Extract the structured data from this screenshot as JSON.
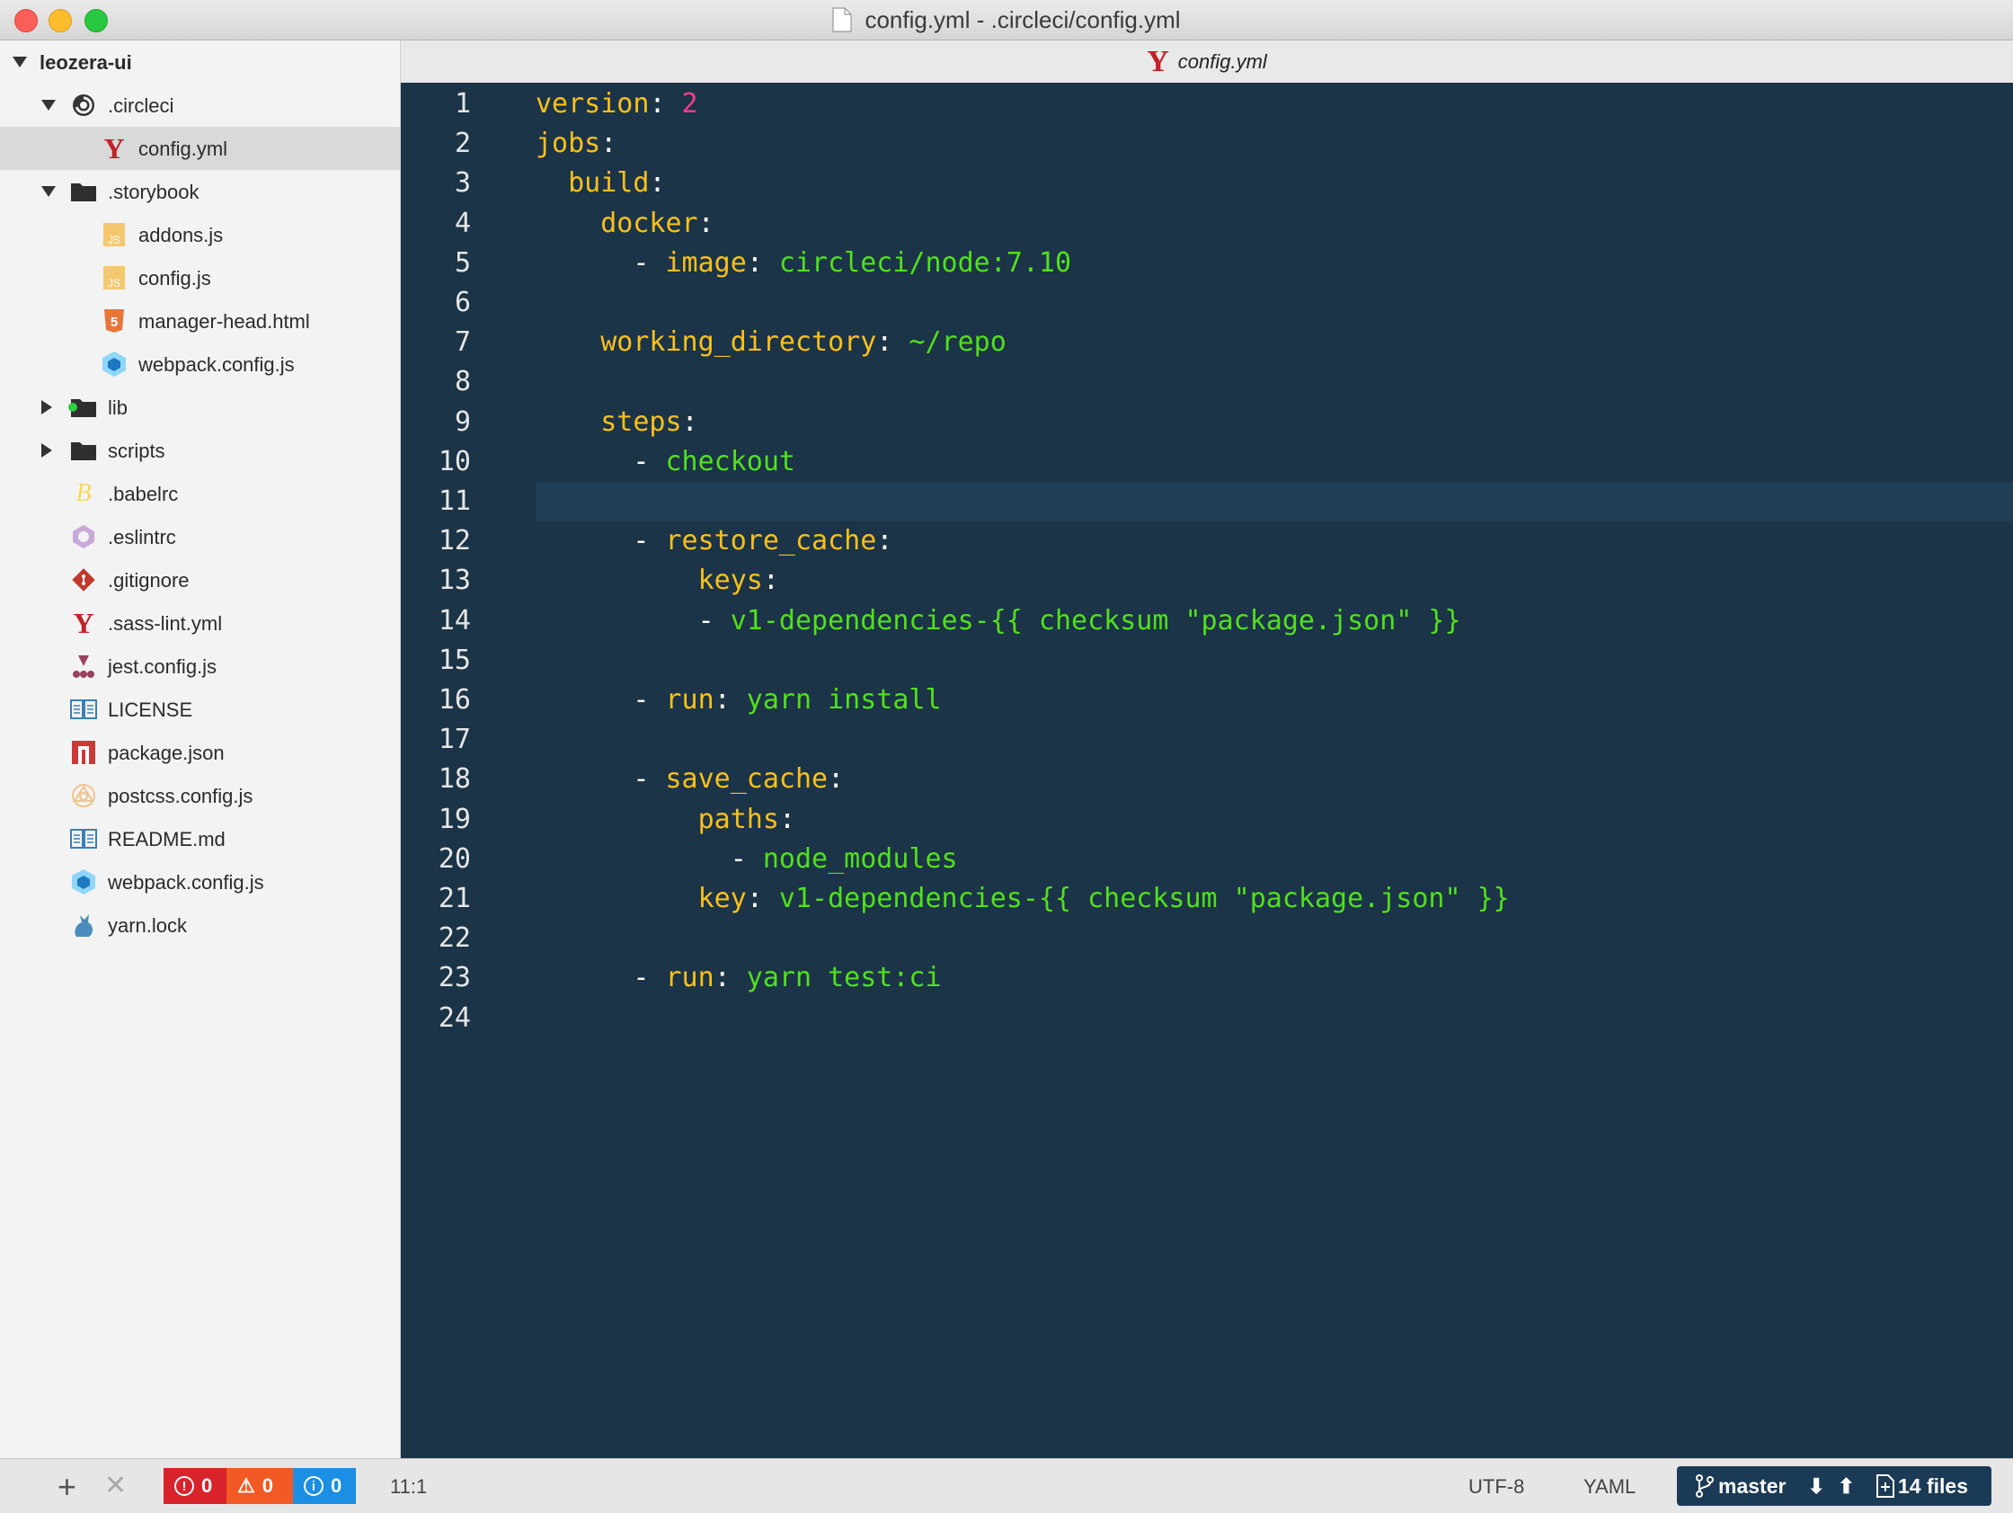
{
  "window": {
    "title": "config.yml - .circleci/config.yml"
  },
  "tab": {
    "label": "config.yml",
    "icon": "yaml-icon"
  },
  "tree": {
    "root": "leozera-ui",
    "items": [
      {
        "label": ".circleci",
        "icon": "circleci-icon",
        "expanded": true
      },
      {
        "label": "config.yml",
        "icon": "yaml-icon",
        "selected": true
      },
      {
        "label": ".storybook",
        "icon": "folder-icon",
        "expanded": true
      },
      {
        "label": "addons.js",
        "icon": "js-icon"
      },
      {
        "label": "config.js",
        "icon": "js-icon"
      },
      {
        "label": "manager-head.html",
        "icon": "html5-icon"
      },
      {
        "label": "webpack.config.js",
        "icon": "webpack-icon"
      },
      {
        "label": "lib",
        "icon": "folder-icon"
      },
      {
        "label": "scripts",
        "icon": "folder-icon"
      },
      {
        "label": ".babelrc",
        "icon": "babel-icon"
      },
      {
        "label": ".eslintrc",
        "icon": "eslint-icon"
      },
      {
        "label": ".gitignore",
        "icon": "git-icon"
      },
      {
        "label": ".sass-lint.yml",
        "icon": "yaml-icon"
      },
      {
        "label": "jest.config.js",
        "icon": "jest-icon"
      },
      {
        "label": "LICENSE",
        "icon": "license-icon"
      },
      {
        "label": "package.json",
        "icon": "npm-icon"
      },
      {
        "label": "postcss.config.js",
        "icon": "postcss-icon"
      },
      {
        "label": "README.md",
        "icon": "readme-icon"
      },
      {
        "label": "webpack.config.js",
        "icon": "webpack-icon"
      },
      {
        "label": "yarn.lock",
        "icon": "yarn-icon"
      }
    ]
  },
  "editor": {
    "current_line": 11,
    "lines": [
      "version: 2",
      "jobs:",
      "  build:",
      "    docker:",
      "      - image: circleci/node:7.10",
      "",
      "    working_directory: ~/repo",
      "",
      "    steps:",
      "      - checkout",
      "",
      "      - restore_cache:",
      "          keys:",
      "          - v1-dependencies-{{ checksum \"package.json\" }}",
      "",
      "      - run: yarn install",
      "",
      "      - save_cache:",
      "          paths:",
      "            - node_modules",
      "          key: v1-dependencies-{{ checksum \"package.json\" }}",
      "",
      "      - run: yarn test:ci",
      ""
    ]
  },
  "status": {
    "errors": "0",
    "warnings": "0",
    "infos": "0",
    "cursor": "11:1",
    "encoding": "UTF-8",
    "grammar": "YAML",
    "branch": "master",
    "changed_files": "14 files"
  },
  "colors": {
    "editor_bg": "#1b3447",
    "key": "#fac01b",
    "string": "#52e01d",
    "number": "#f53c8c",
    "error": "#d8232a",
    "warning": "#f15a24",
    "info": "#1a8fe3"
  }
}
